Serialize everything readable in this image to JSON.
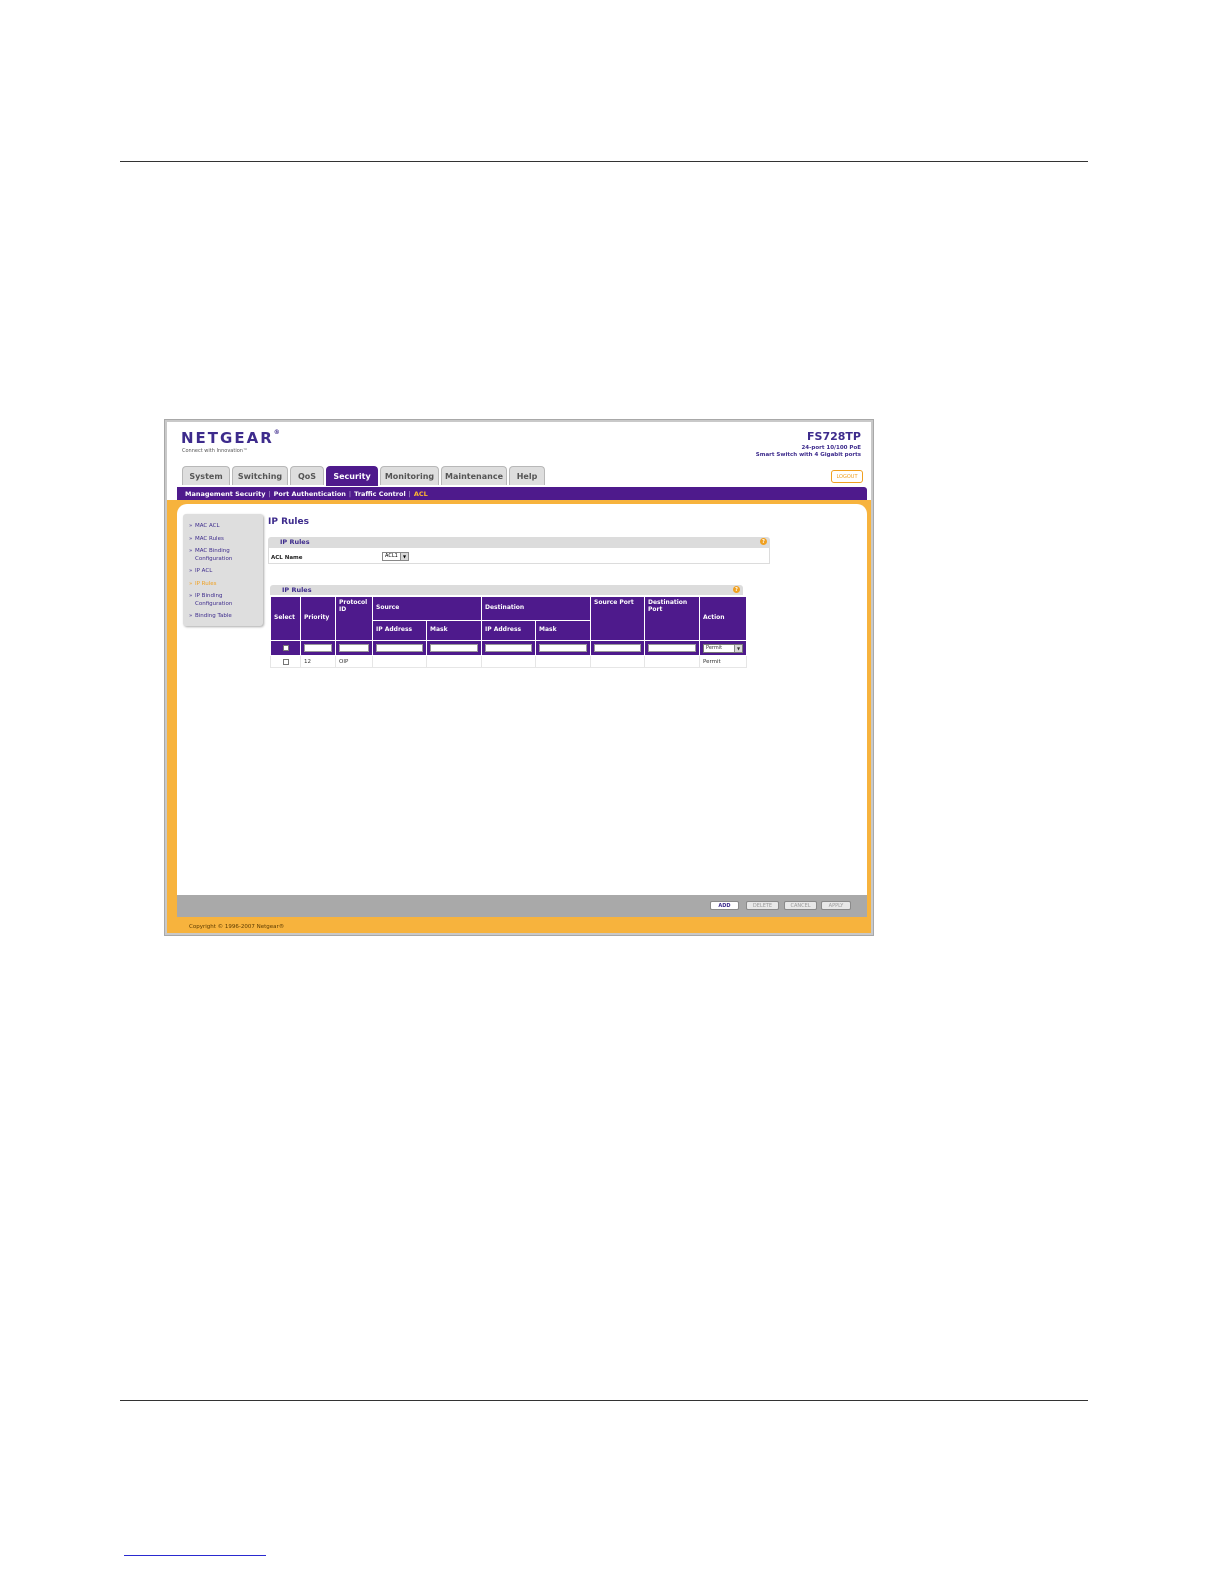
{
  "header": {
    "brand": "NETGEAR",
    "brand_mark": "®",
    "tagline": "Connect with Innovation™",
    "model": "FS728TP",
    "model_desc_line1": "24-port 10/100 PoE",
    "model_desc_line2": "Smart Switch with 4 Gigabit ports",
    "logout": "LOGOUT"
  },
  "tabs": [
    "System",
    "Switching",
    "QoS",
    "Security",
    "Monitoring",
    "Maintenance",
    "Help"
  ],
  "subnav": [
    "Management Security",
    "Port Authentication",
    "Traffic Control",
    "ACL"
  ],
  "sidebar": [
    "MAC ACL",
    "MAC Rules",
    "MAC Binding Configuration",
    "IP ACL",
    "IP Rules",
    "IP Binding Configuration",
    "Binding Table"
  ],
  "page_title": "IP Rules",
  "panel1": {
    "title": "IP Rules",
    "acl_name_label": "ACL Name",
    "acl_name_value": "ACL1"
  },
  "panel2": {
    "title": "IP Rules"
  },
  "table": {
    "headers": {
      "select": "Select",
      "priority": "Priority",
      "protocol": "Protocol ID",
      "source": "Source",
      "destination": "Destination",
      "source_port": "Source Port",
      "destination_port": "Destination Port",
      "action": "Action",
      "ip_address": "IP Address",
      "mask": "Mask"
    },
    "input_action": "Permit",
    "row": {
      "priority": "12",
      "protocol": "OIP",
      "action": "Permit"
    }
  },
  "buttons": {
    "add": "ADD",
    "delete": "DELETE",
    "cancel": "CANCEL",
    "apply": "APPLY"
  },
  "copyright": "Copyright © 1996-2007 Netgear®"
}
